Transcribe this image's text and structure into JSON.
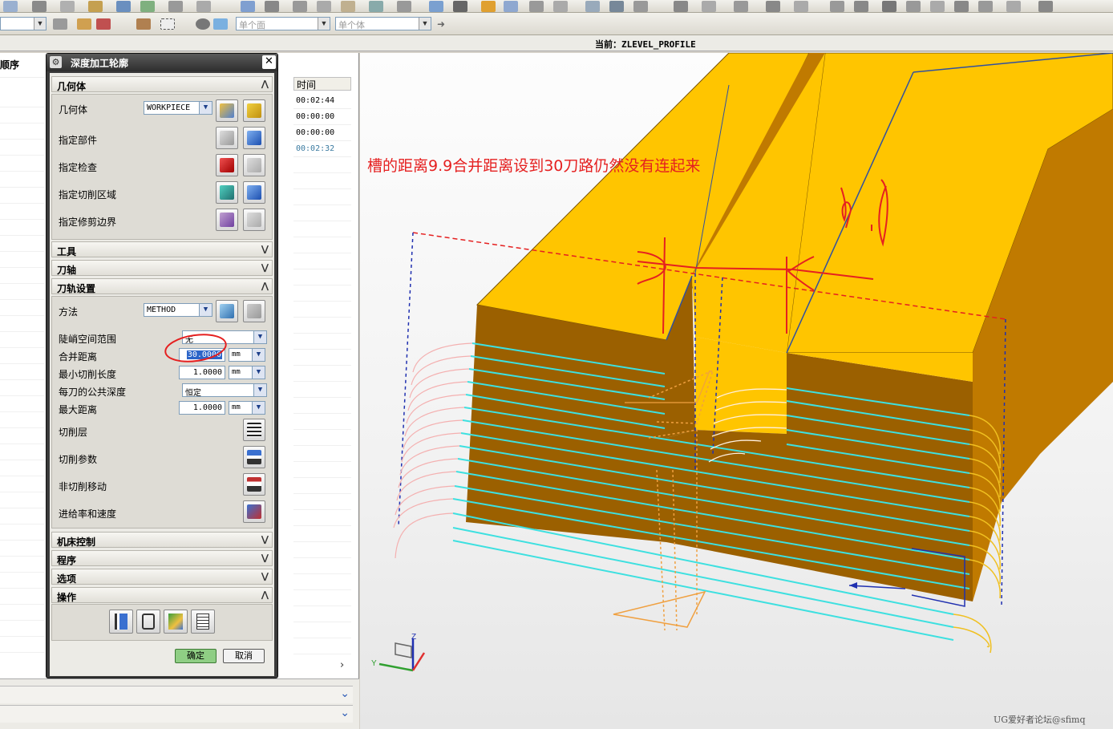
{
  "status": {
    "current_label": "当前：ZLEVEL_PROFILE"
  },
  "toolbar2": {
    "filter1": "单个面",
    "filter2": "单个体"
  },
  "navigator": {
    "header_left": "顺序",
    "header_time": "时间",
    "times": [
      "00:02:44",
      "00:00:00",
      "00:00:00",
      "00:02:32"
    ]
  },
  "dialog": {
    "title": "深度加工轮廓",
    "close": "✕",
    "sections": {
      "geometry": "几何体",
      "tools": "工具",
      "tool_axis": "刀轴",
      "path_settings": "刀轨设置",
      "machine_control": "机床控制",
      "program": "程序",
      "options": "选项",
      "actions": "操作"
    },
    "geometry": {
      "geometry_label": "几何体",
      "geometry_value": "WORKPIECE",
      "specify_part": "指定部件",
      "specify_check": "指定检查",
      "specify_cut_area": "指定切削区域",
      "specify_trim": "指定修剪边界"
    },
    "path": {
      "method_label": "方法",
      "method_value": "METHOD",
      "steep_label": "陡峭空间范围",
      "steep_value": "无",
      "merge_label": "合并距离",
      "merge_value": "30.0000",
      "merge_unit": "mm",
      "min_cut_label": "最小切削长度",
      "min_cut_value": "1.0000",
      "min_cut_unit": "mm",
      "depth_label": "每刀的公共深度",
      "depth_value": "恒定",
      "max_dist_label": "最大距离",
      "max_dist_value": "1.0000",
      "max_dist_unit": "mm",
      "cut_levels": "切削层",
      "cut_params": "切削参数",
      "non_cut": "非切削移动",
      "feeds": "进给率和速度"
    },
    "ok": "确定",
    "cancel": "取消"
  },
  "viewport": {
    "annotation": "槽的距离9.9合并距离设到30刀路仍然没有连起来",
    "watermark": "UG爱好者论坛@sfimq",
    "triad_x": "Y",
    "triad_z": "Z"
  },
  "colors": {
    "part_top": "#ffc500",
    "part_side": "#c07a00",
    "part_front": "#9b6000",
    "toolpath_cyan": "#3de0e0",
    "toolpath_orange": "#f0a040",
    "annotation_red": "#e52020"
  }
}
